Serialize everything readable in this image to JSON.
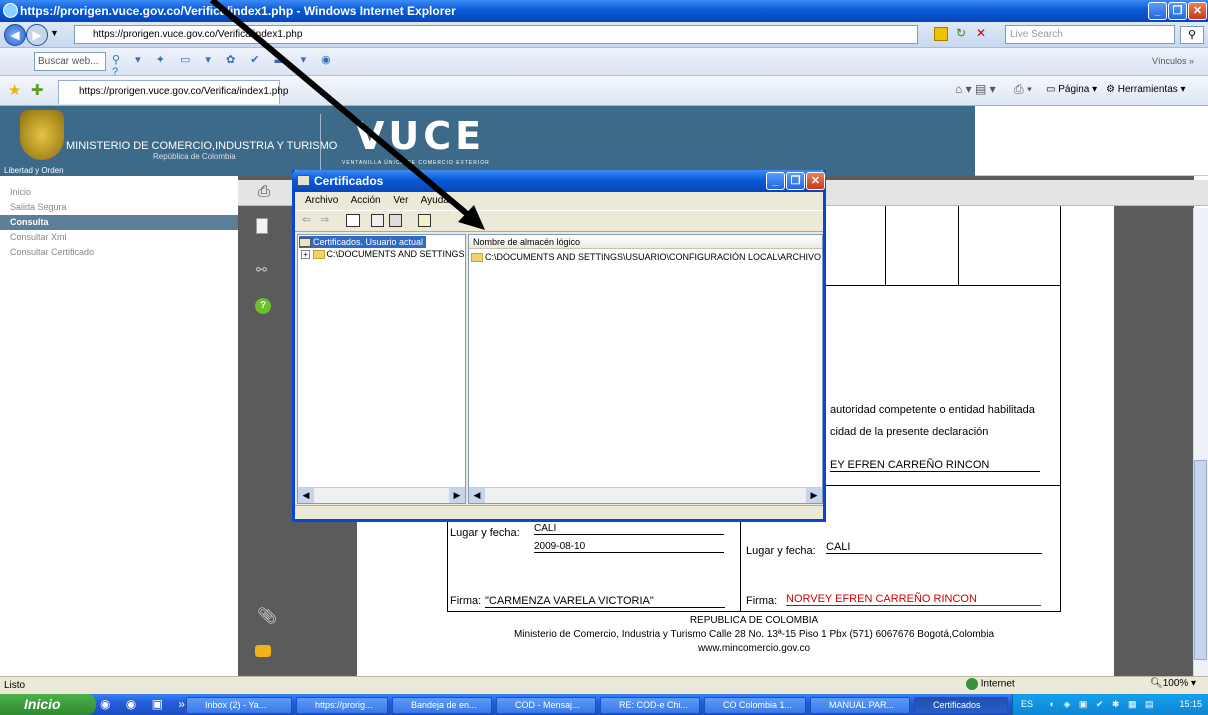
{
  "window": {
    "title": "https://prorigen.vuce.gov.co/Verifica/index1.php - Windows Internet Explorer"
  },
  "address": {
    "url": "https://prorigen.vuce.gov.co/Verifica/index1.php",
    "search_placeholder": "Live Search"
  },
  "toolbar": {
    "search_web": "Buscar web...",
    "vinculos": "Vínculos"
  },
  "tab": {
    "label": "https://prorigen.vuce.gov.co/Verifica/index1.php"
  },
  "cmdbar": {
    "pagina": "Página",
    "herramientas": "Herramientas"
  },
  "banner": {
    "ministerio": "MINISTERIO DE COMERCIO,INDUSTRIA Y TURISMO",
    "republica": "República de Colombia",
    "libertad": "Libertad y Orden",
    "vuce": "VUCE",
    "vuce_sub": "VENTANILLA ÚNICA DE COMERCIO EXTERIOR"
  },
  "nav": {
    "items": [
      "Inicio",
      "Salida Segura",
      "Consulta",
      "Consultar Xml",
      "Consultar Certificado"
    ]
  },
  "document": {
    "autoridad": "autoridad competente o entidad habilitada",
    "veracidad": "cidad de la presente declaración",
    "nombre_partial": "EY EFREN CARREÑO RINCON",
    "lugar_label_left": "Lugar y fecha:",
    "lugar_left": "CALI",
    "fecha_left": "2009-08-10",
    "lugar_label_right": "Lugar y fecha:",
    "lugar_right": "CALI",
    "firma_left_label": "Firma:",
    "firma_left": "\"CARMENZA  VARELA VICTORIA\"",
    "firma_right_label": "Firma:",
    "firma_right": "NORVEY EFREN CARREÑO RINCON",
    "footer1": "REPUBLICA DE COLOMBIA",
    "footer2": "Ministerio de Comercio, Industria y Turismo Calle 28 No. 13ª-15 Piso 1 Pbx (571) 6067676  Bogotá,Colombia",
    "footer3": "www.mincomercio.gov.co"
  },
  "dialog": {
    "title": "Certificados",
    "menu": [
      "Archivo",
      "Acción",
      "Ver",
      "Ayuda"
    ],
    "tree_root": "Certificados. Usuario actual",
    "tree_child": "C:\\DOCUMENTS AND SETTINGS\\",
    "col_header": "Nombre de almacén lógico",
    "list_item": "C:\\DOCUMENTS AND SETTINGS\\USUARIO\\CONFIGURACIÓN LOCAL\\ARCHIVOS TEMI"
  },
  "status": {
    "left": "Listo",
    "zone": "Internet",
    "zoom": "100%"
  },
  "taskbar": {
    "start": "Inicio",
    "tasks": [
      "Inbox (2) - Ya...",
      "https://prorig...",
      "Bandeja de en...",
      "COD - Mensaj...",
      "RE: COD-e Chi...",
      "CO Colombia 1...",
      "MANUAL PAR...",
      "Certificados"
    ],
    "lang": "ES",
    "clock": "15:15"
  }
}
